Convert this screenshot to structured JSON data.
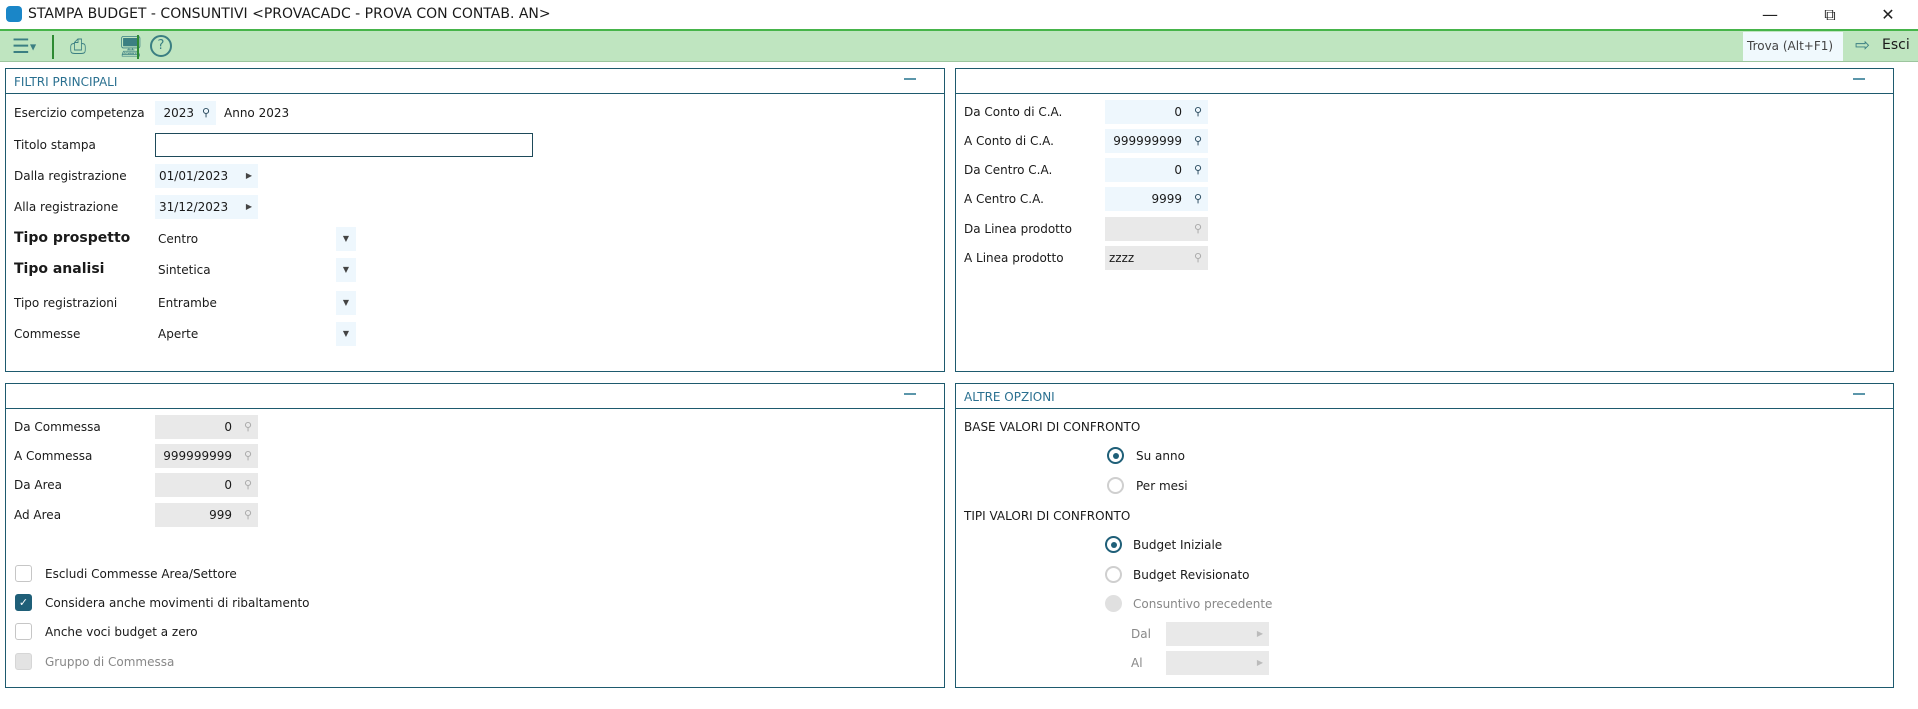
{
  "window": {
    "title": "STAMPA BUDGET - CONSUNTIVI <PROVACADC - PROVA CON CONTAB. AN>"
  },
  "toolbar": {
    "find_label": "Trova (Alt+F1)",
    "exit_label": "Esci"
  },
  "filtri": {
    "title": "FILTRI PRINCIPALI",
    "esercizio": {
      "label": "Esercizio competenza",
      "value": "2023",
      "desc": "Anno 2023"
    },
    "titolo": {
      "label": "Titolo stampa",
      "value": ""
    },
    "dalla": {
      "label": "Dalla registrazione",
      "value": "01/01/2023"
    },
    "alla": {
      "label": "Alla registrazione",
      "value": "31/12/2023"
    },
    "tipo_prospetto": {
      "label": "Tipo prospetto",
      "value": "Centro"
    },
    "tipo_analisi": {
      "label": "Tipo analisi",
      "value": "Sintetica"
    },
    "tipo_registrazioni": {
      "label": "Tipo registrazioni",
      "value": "Entrambe"
    },
    "commesse": {
      "label": "Commesse",
      "value": "Aperte"
    }
  },
  "conti": {
    "rows": [
      {
        "label": "Da Conto di C.A.",
        "value": "0"
      },
      {
        "label": "A Conto di C.A.",
        "value": "999999999"
      },
      {
        "label": "Da Centro C.A.",
        "value": "0"
      },
      {
        "label": "A Centro C.A.",
        "value": "9999"
      },
      {
        "label": "Da Linea prodotto",
        "value": ""
      },
      {
        "label": "A Linea prodotto",
        "value": "zzzz"
      }
    ]
  },
  "commesse_panel": {
    "rows": [
      {
        "label": "Da Commessa",
        "value": "0"
      },
      {
        "label": "A Commessa",
        "value": "999999999"
      },
      {
        "label": "Da Area",
        "value": "0"
      },
      {
        "label": "Ad Area",
        "value": "999"
      }
    ],
    "checks": [
      {
        "label": "Escludi Commesse Area/Settore",
        "checked": false
      },
      {
        "label": "Considera anche movimenti di ribaltamento",
        "checked": true
      },
      {
        "label": "Anche voci budget a zero",
        "checked": false
      },
      {
        "label": "Gruppo di Commessa",
        "checked": false
      }
    ]
  },
  "altre": {
    "title": "ALTRE OPZIONI",
    "base_title": "BASE VALORI DI CONFRONTO",
    "base_options": [
      "Su anno",
      "Per mesi"
    ],
    "base_selected": "Su anno",
    "tipi_title": "TIPI VALORI DI CONFRONTO",
    "tipi_options": [
      "Budget Iniziale",
      "Budget Revisionato",
      "Consuntivo precedente"
    ],
    "tipi_selected": "Budget Iniziale",
    "dal_label": "Dal",
    "al_label": "Al"
  }
}
